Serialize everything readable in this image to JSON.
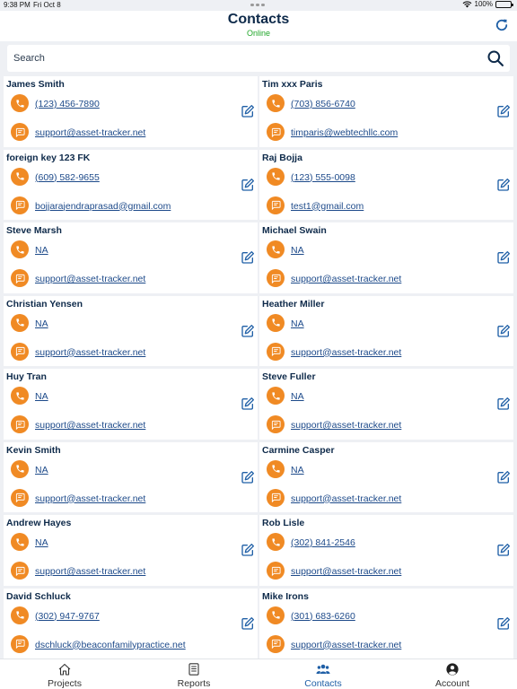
{
  "status_bar": {
    "time": "9:38 PM",
    "date": "Fri Oct 8",
    "battery": "100%"
  },
  "header": {
    "title": "Contacts",
    "status": "Online"
  },
  "search": {
    "placeholder": "Search"
  },
  "contacts": [
    {
      "name": "James Smith",
      "phone": "(123) 456-7890",
      "email": "support@asset-tracker.net"
    },
    {
      "name": "Tim xxx Paris",
      "phone": "(703) 856-6740",
      "email": "timparis@webtechllc.com"
    },
    {
      "name": "foreign key 123 FK",
      "phone": "(609) 582-9655",
      "email": "bojjarajendraprasad@gmail.com"
    },
    {
      "name": "Raj Bojja",
      "phone": "(123) 555-0098",
      "email": "test1@gmail.com"
    },
    {
      "name": "Steve Marsh",
      "phone": "NA",
      "email": "support@asset-tracker.net"
    },
    {
      "name": "Michael Swain",
      "phone": "NA",
      "email": "support@asset-tracker.net"
    },
    {
      "name": "Christian Yensen",
      "phone": "NA",
      "email": "support@asset-tracker.net"
    },
    {
      "name": "Heather Miller",
      "phone": "NA",
      "email": "support@asset-tracker.net"
    },
    {
      "name": "Huy Tran",
      "phone": "NA",
      "email": "support@asset-tracker.net"
    },
    {
      "name": "Steve Fuller",
      "phone": "NA",
      "email": "support@asset-tracker.net"
    },
    {
      "name": "Kevin Smith",
      "phone": "NA",
      "email": "support@asset-tracker.net"
    },
    {
      "name": "Carmine Casper",
      "phone": "NA",
      "email": "support@asset-tracker.net"
    },
    {
      "name": "Andrew Hayes",
      "phone": "NA",
      "email": "support@asset-tracker.net"
    },
    {
      "name": "Rob Lisle",
      "phone": "(302) 841-2546",
      "email": "support@asset-tracker.net"
    },
    {
      "name": "David Schluck",
      "phone": "(302) 947-9767",
      "email": "dschluck@beaconfamilypractice.net"
    },
    {
      "name": "Mike Irons",
      "phone": "(301) 683-6260",
      "email": "support@asset-tracker.net"
    }
  ],
  "tabs": [
    {
      "label": "Projects",
      "icon": "home-icon"
    },
    {
      "label": "Reports",
      "icon": "document-icon"
    },
    {
      "label": "Contacts",
      "icon": "users-icon",
      "active": true
    },
    {
      "label": "Account",
      "icon": "user-circle-icon"
    }
  ],
  "colors": {
    "accent": "#1f5fa6",
    "icon_bg": "#f08a24",
    "online": "#22a72b",
    "text": "#0e2a4a"
  }
}
